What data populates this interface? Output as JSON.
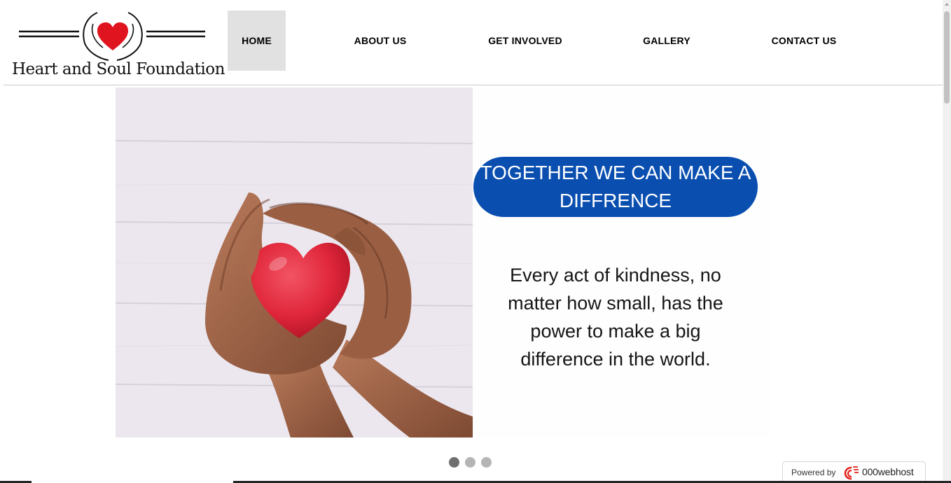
{
  "brand": {
    "name": "Heart and Soul Foundation",
    "heart_color": "#e0141e"
  },
  "nav": {
    "items": [
      {
        "label": "HOME",
        "active": true
      },
      {
        "label": "ABOUT US",
        "active": false
      },
      {
        "label": "GET INVOLVED",
        "active": false
      },
      {
        "label": "GALLERY",
        "active": false
      },
      {
        "label": "CONTACT US",
        "active": false
      }
    ]
  },
  "hero": {
    "headline": "TOGETHER WE CAN MAKE A DIFFRENCE",
    "quote": "Every act of kindness, no matter how small, has the power to make a big difference in the world.",
    "pill_color": "#0a4fb0",
    "photo_icon": "hands-holding-heart-icon"
  },
  "carousel": {
    "slide_count": 3,
    "active_index": 0
  },
  "footer_badge": {
    "label": "Powered by",
    "brand": "000webhost",
    "icon": "webhost-logo-icon"
  }
}
